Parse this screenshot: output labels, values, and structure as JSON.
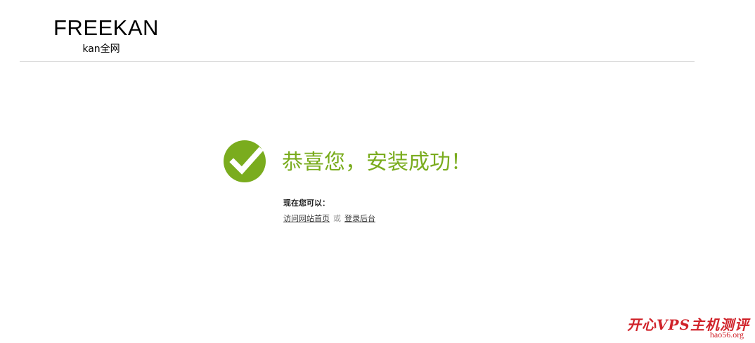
{
  "header": {
    "logo_title": "FREEKAN",
    "logo_subtitle": "kan全网"
  },
  "success": {
    "title": "恭喜您，安装成功！",
    "now_label": "现在您可以：",
    "visit_link": "访问网站首页",
    "or_text": "或",
    "admin_link": "登录后台"
  },
  "watermark": {
    "main": "开心VPS主机测评",
    "sub": "hao56.org"
  },
  "colors": {
    "accent_green": "#7aac1e",
    "watermark_red": "#d0232a"
  },
  "icons": {
    "success": "check-circle-icon"
  }
}
